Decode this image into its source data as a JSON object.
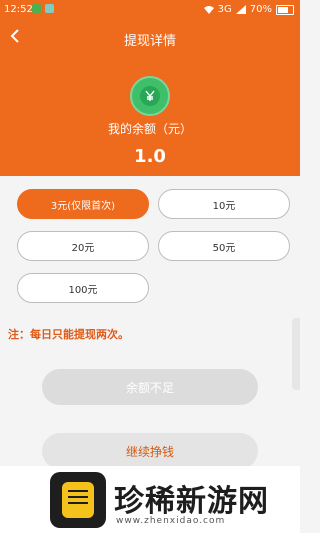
{
  "status": {
    "time": "12:52",
    "signal": "3G",
    "battery": "70%"
  },
  "header": {
    "title": "提现详情",
    "balance_label": "我的余额（元）",
    "balance_value": "1.0"
  },
  "options": [
    "3元(仅限首次)",
    "10元",
    "20元",
    "50元",
    "100元"
  ],
  "selected_option": "3元(仅限首次)",
  "note": "注：每日只能提现两次。",
  "buttons": {
    "insufficient": "余额不足",
    "continue": "继续挣钱"
  },
  "banner": {
    "brand": "珍稀新游网",
    "url": "www.zhenxidao.com"
  },
  "colors": {
    "primary": "#ee6a1c",
    "coin": "#3fbf6a"
  }
}
